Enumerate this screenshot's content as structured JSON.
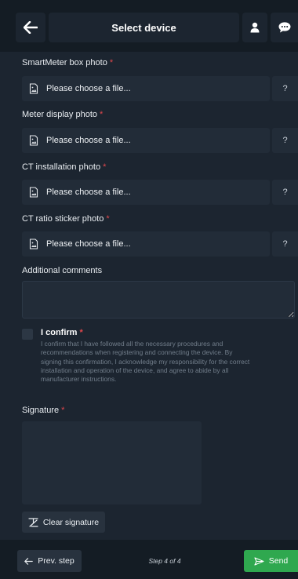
{
  "header": {
    "title": "Select device",
    "back_icon": "arrow-left-icon",
    "user_icon": "user-icon",
    "chat_icon": "chat-bubble-icon"
  },
  "form": {
    "required_marker": "*",
    "file_fields": [
      {
        "label": "SmartMeter box photo",
        "placeholder": "Please choose a file...",
        "help": "?"
      },
      {
        "label": "Meter display photo",
        "placeholder": "Please choose a file...",
        "help": "?"
      },
      {
        "label": "CT installation photo",
        "placeholder": "Please choose a file...",
        "help": "?"
      },
      {
        "label": "CT ratio sticker photo",
        "placeholder": "Please choose a file...",
        "help": "?"
      }
    ],
    "comments_label": "Additional comments",
    "comments_value": "",
    "confirm": {
      "checked": false,
      "title": "I confirm",
      "text": "I confirm that I have followed all the necessary procedures and recommendations when registering and connecting the device. By signing this confirmation, I acknowledge my responsibility for the correct installation and operation of the device, and agree to abide by all manufacturer instructions."
    },
    "signature_label": "Signature",
    "clear_signature": "Clear signature"
  },
  "footer": {
    "prev_label": "Prev. step",
    "step_text": "Step 4 of 4",
    "send_label": "Send"
  },
  "colors": {
    "background": "#1c2530",
    "header": "#141c24",
    "field": "#222c38",
    "required": "#e0474c",
    "send": "#2fa84f"
  }
}
